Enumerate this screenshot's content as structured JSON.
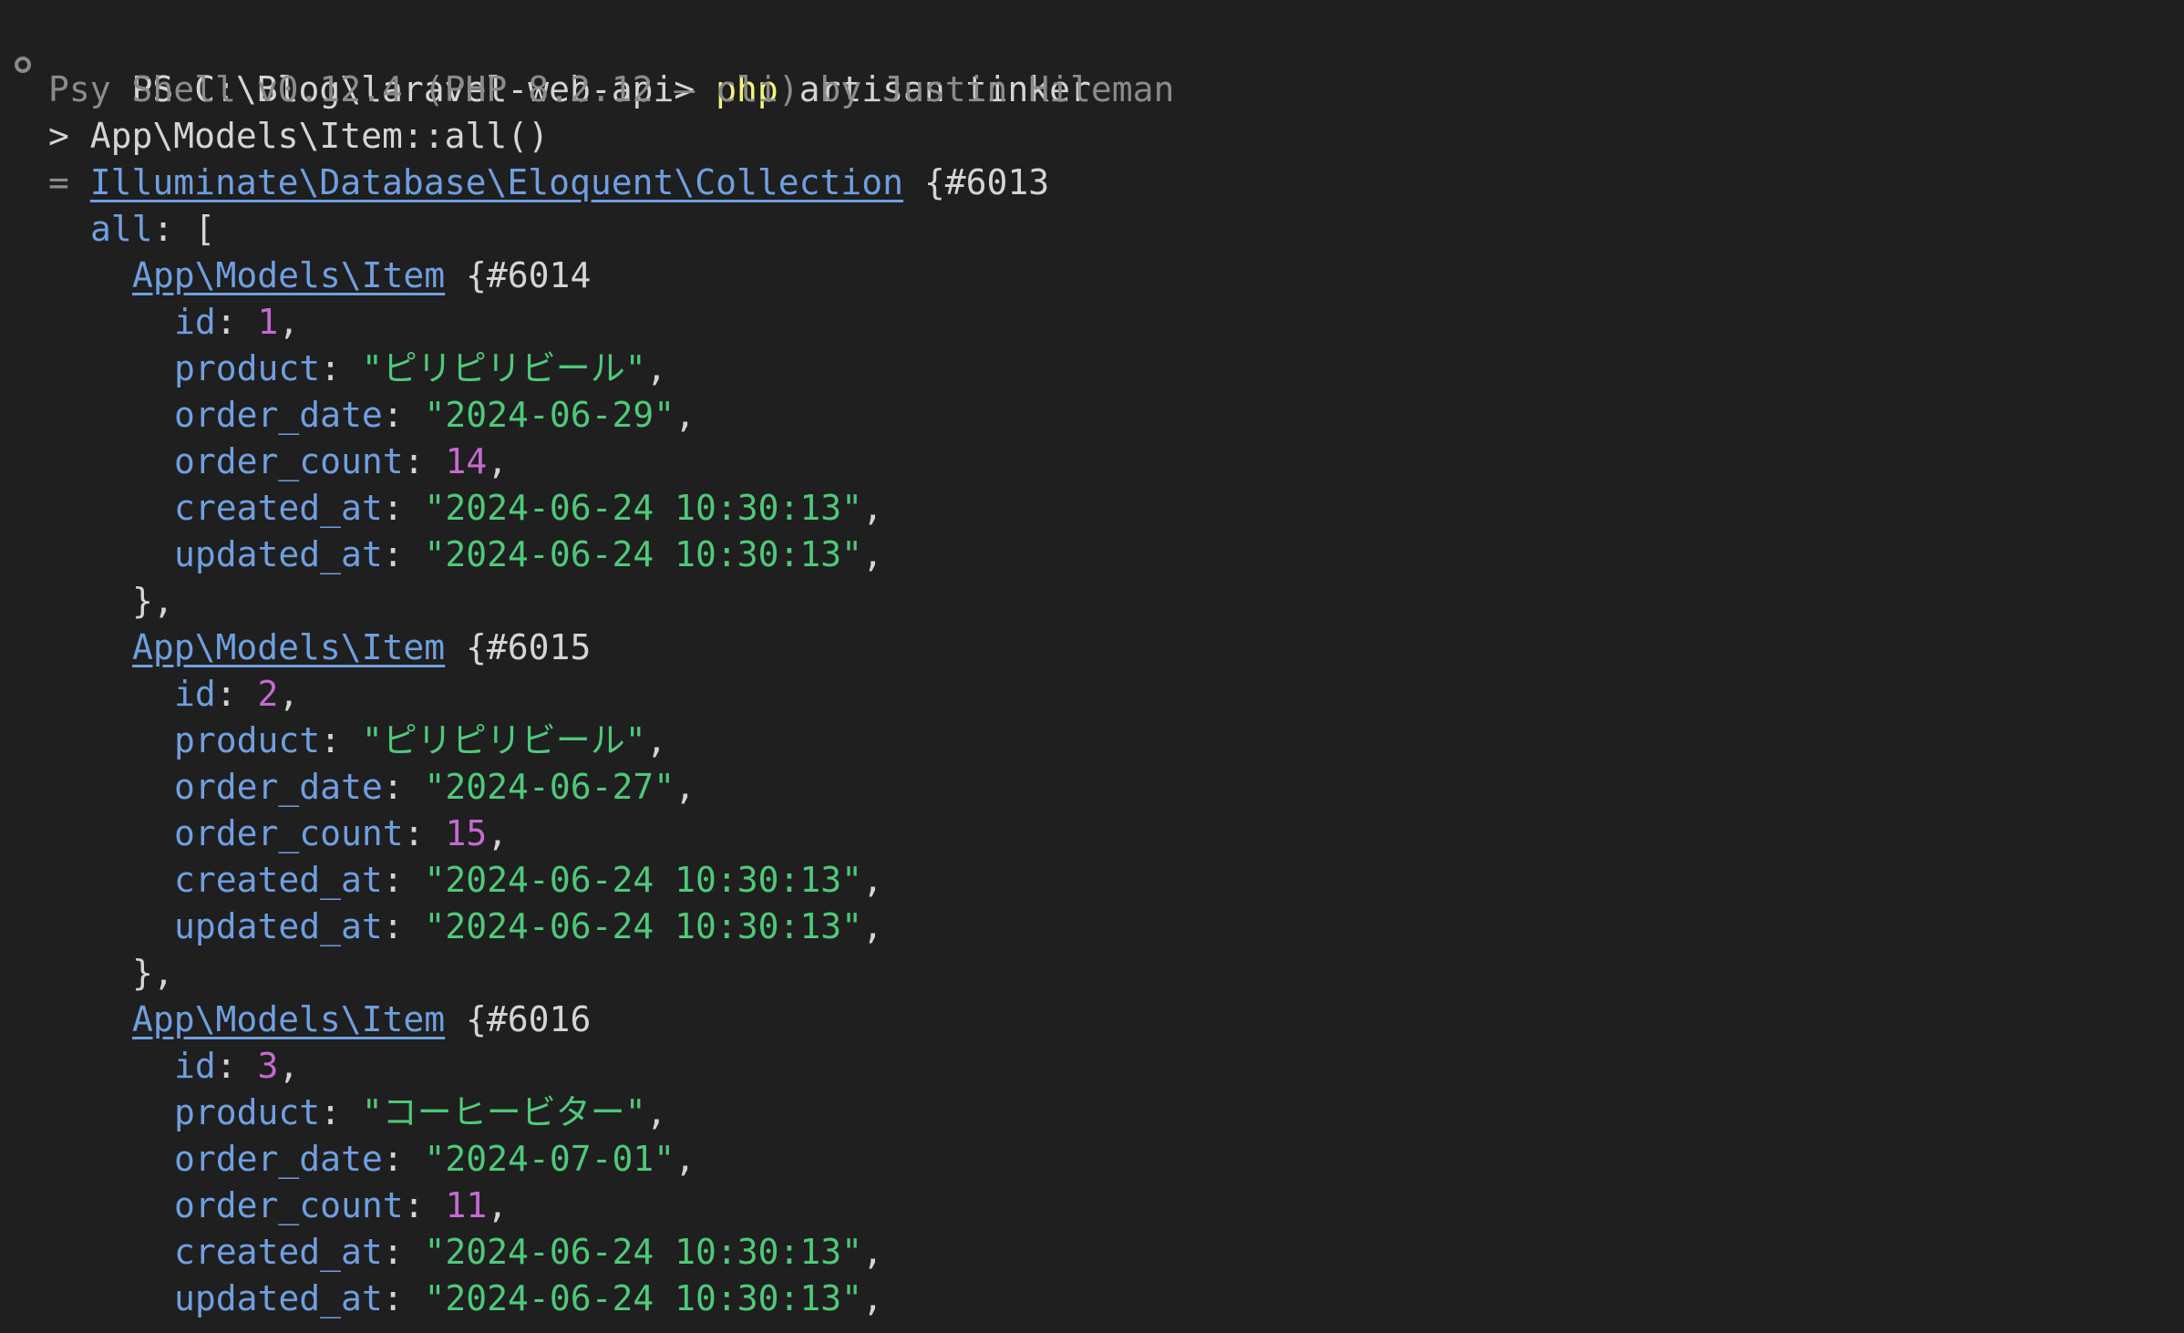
{
  "prompt": {
    "prefix": "PS C:\\Blog\\laravel-web-api> ",
    "command": "php",
    "args": " artisan tinker"
  },
  "banner": "Psy Shell v0.12.4 (PHP 8.2.12 — cli) by Justin Hileman",
  "input_line": "> App\\Models\\Item::all()",
  "result": {
    "marker": "= ",
    "class_name": "Illuminate\\Database\\Eloquent\\Collection",
    "object_id": " {#6013",
    "all_key": "all",
    "all_open": ": [",
    "items": [
      {
        "class_name": "App\\Models\\Item",
        "object_id": " {#6014",
        "id": "1",
        "product": "\"ピリピリビール\"",
        "order_date": "\"2024-06-29\"",
        "order_count": "14",
        "created_at": "\"2024-06-24 10:30:13\"",
        "updated_at": "\"2024-06-24 10:30:13\"",
        "close": "},"
      },
      {
        "class_name": "App\\Models\\Item",
        "object_id": " {#6015",
        "id": "2",
        "product": "\"ピリピリビール\"",
        "order_date": "\"2024-06-27\"",
        "order_count": "15",
        "created_at": "\"2024-06-24 10:30:13\"",
        "updated_at": "\"2024-06-24 10:30:13\"",
        "close": "},"
      },
      {
        "class_name": "App\\Models\\Item",
        "object_id": " {#6016",
        "id": "3",
        "product": "\"コーヒービター\"",
        "order_date": "\"2024-07-01\"",
        "order_count": "11",
        "created_at": "\"2024-06-24 10:30:13\"",
        "updated_at": "\"2024-06-24 10:30:13\""
      }
    ]
  },
  "field_keys": {
    "id": "id",
    "product": "product",
    "order_date": "order_date",
    "order_count": "order_count",
    "created_at": "created_at",
    "updated_at": "updated_at"
  },
  "colors": {
    "background": "#1f1f1f",
    "command": "#f4f47a",
    "key": "#6f9fe0",
    "number": "#c56ad1",
    "string": "#4ec979"
  }
}
